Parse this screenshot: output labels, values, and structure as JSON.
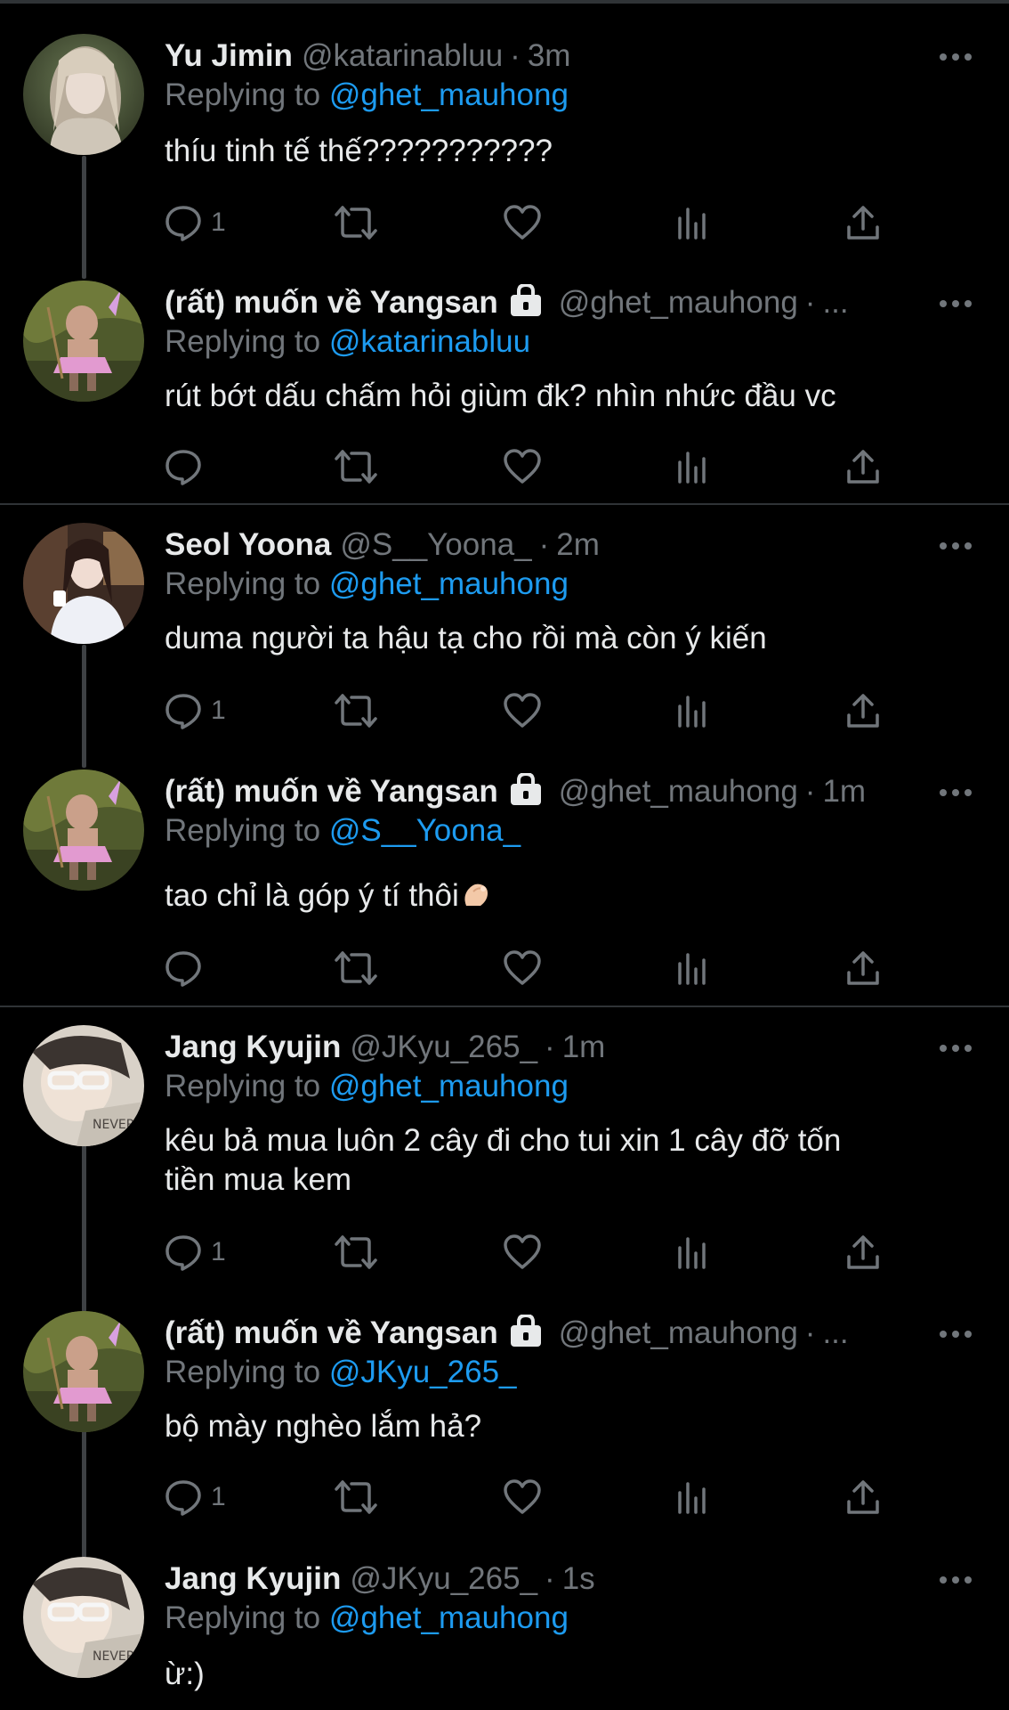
{
  "tweets": [
    {
      "name": "Yu Jimin",
      "handle": "@katarinabluu",
      "dot": "·",
      "time": "3m",
      "replying_label": "Replying to",
      "replying_to": "@ghet_mauhong",
      "text": "thíu tinh tế thế???????????",
      "reply_count": "1",
      "locked": false,
      "avatar": "girl-long-hair-photo"
    },
    {
      "name": "(rất) muốn về Yangsan",
      "handle": "@ghet_mauhong",
      "dot": "·",
      "time": "...",
      "replying_label": "Replying to",
      "replying_to": "@katarinabluu",
      "text": "rút bớt dấu chấm hỏi giùm đk? nhìn nhức đầu vc",
      "reply_count": "",
      "locked": true,
      "avatar": "fairy-character-photo"
    },
    {
      "name": "Seol Yoona",
      "handle": "@S__Yoona_",
      "dot": "·",
      "time": "2m",
      "replying_label": "Replying to",
      "replying_to": "@ghet_mauhong",
      "text": "duma người ta hậu tạ cho rồi mà còn ý kiến",
      "reply_count": "1",
      "locked": false,
      "avatar": "girl-white-coat-photo"
    },
    {
      "name": "(rất) muốn về Yangsan",
      "handle": "@ghet_mauhong",
      "dot": "·",
      "time": "1m",
      "replying_label": "Replying to",
      "replying_to": "@S__Yoona_",
      "text": "tao chỉ là góp ý tí thôi",
      "reply_count": "",
      "locked": true,
      "avatar": "fairy-character-photo",
      "emoji": "pinching-hand-emoji"
    },
    {
      "name": "Jang Kyujin",
      "handle": "@JKyu_265_",
      "dot": "·",
      "time": "1m",
      "replying_label": "Replying to",
      "replying_to": "@ghet_mauhong",
      "text_lines": [
        "kêu bả mua luôn 2 cây đi cho tui xin 1 cây đỡ tốn",
        "tiền mua kem"
      ],
      "reply_count": "1",
      "locked": false,
      "avatar": "girl-glasses-photo"
    },
    {
      "name": "(rất) muốn về Yangsan",
      "handle": "@ghet_mauhong",
      "dot": "·",
      "time": "...",
      "replying_label": "Replying to",
      "replying_to": "@JKyu_265_",
      "text": "bộ mày nghèo lắm hả?",
      "reply_count": "1",
      "locked": true,
      "avatar": "fairy-character-photo"
    },
    {
      "name": "Jang Kyujin",
      "handle": "@JKyu_265_",
      "dot": "·",
      "time": "1s",
      "replying_label": "Replying to",
      "replying_to": "@ghet_mauhong",
      "text": "ừ:)",
      "reply_count": "",
      "locked": false,
      "avatar": "girl-glasses-photo"
    }
  ],
  "icons": {
    "reply": "reply-icon",
    "retweet": "retweet-icon",
    "like": "heart-icon",
    "analytics": "analytics-icon",
    "share": "share-icon",
    "more": "more-icon",
    "lock": "lock-icon"
  },
  "colors": {
    "background": "#000000",
    "text": "#E7E9EA",
    "secondary": "#71767B",
    "mention": "#1D9BF0",
    "divider": "#2F3336"
  }
}
